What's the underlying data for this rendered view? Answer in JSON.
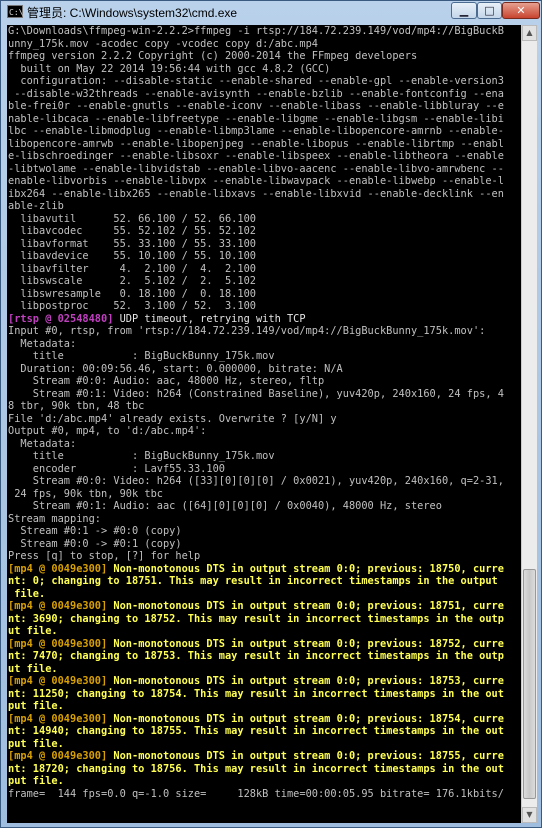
{
  "window": {
    "app_icon_text": "C:\\",
    "title": "管理员: C:\\Windows\\system32\\cmd.exe",
    "minimize_symbol": "▁",
    "maximize_symbol": "□",
    "close_symbol": "✕"
  },
  "console_lines": [
    {
      "t": "G:\\Downloads\\ffmpeg-win-2.2.2>ffmpeg -i rtsp://184.72.239.149/vod/mp4://BigBuckB"
    },
    {
      "t": "unny_175k.mov -acodec copy -vcodec copy d:/abc.mp4"
    },
    {
      "t": "ffmpeg version 2.2.2 Copyright (c) 2000-2014 the FFmpeg developers"
    },
    {
      "t": "  built on May 22 2014 19:56:44 with gcc 4.8.2 (GCC)"
    },
    {
      "t": "  configuration: --disable-static --enable-shared --enable-gpl --enable-version3"
    },
    {
      "t": " --disable-w32threads --enable-avisynth --enable-bzlib --enable-fontconfig --ena"
    },
    {
      "t": "ble-frei0r --enable-gnutls --enable-iconv --enable-libass --enable-libbluray --e"
    },
    {
      "t": "nable-libcaca --enable-libfreetype --enable-libgme --enable-libgsm --enable-libi"
    },
    {
      "t": "lbc --enable-libmodplug --enable-libmp3lame --enable-libopencore-amrnb --enable-"
    },
    {
      "t": "libopencore-amrwb --enable-libopenjpeg --enable-libopus --enable-librtmp --enabl"
    },
    {
      "t": "e-libschroedinger --enable-libsoxr --enable-libspeex --enable-libtheora --enable"
    },
    {
      "t": "-libtwolame --enable-libvidstab --enable-libvo-aacenc --enable-libvo-amrwbenc --"
    },
    {
      "t": "enable-libvorbis --enable-libvpx --enable-libwavpack --enable-libwebp --enable-l"
    },
    {
      "t": "ibx264 --enable-libx265 --enable-libxavs --enable-libxvid --enable-decklink --en"
    },
    {
      "t": "able-zlib"
    },
    {
      "t": "  libavutil      52. 66.100 / 52. 66.100"
    },
    {
      "t": "  libavcodec     55. 52.102 / 55. 52.102"
    },
    {
      "t": "  libavformat    55. 33.100 / 55. 33.100"
    },
    {
      "t": "  libavdevice    55. 10.100 / 55. 10.100"
    },
    {
      "t": "  libavfilter     4.  2.100 /  4.  2.100"
    },
    {
      "t": "  libswscale      2.  5.102 /  2.  5.102"
    },
    {
      "t": "  libswresample   0. 18.100 /  0. 18.100"
    },
    {
      "t": "  libpostproc    52.  3.100 / 52.  3.100"
    },
    {
      "tag": "[rtsp @ 02548480] ",
      "tag_style": "violet",
      "t": "UDP timeout, retrying with TCP",
      "style": "bright"
    },
    {
      "t": "Input #0, rtsp, from 'rtsp://184.72.239.149/vod/mp4://BigBuckBunny_175k.mov':"
    },
    {
      "t": "  Metadata:"
    },
    {
      "t": "    title           : BigBuckBunny_175k.mov"
    },
    {
      "t": "  Duration: 00:09:56.46, start: 0.000000, bitrate: N/A"
    },
    {
      "t": "    Stream #0:0: Audio: aac, 48000 Hz, stereo, fltp"
    },
    {
      "t": "    Stream #0:1: Video: h264 (Constrained Baseline), yuv420p, 240x160, 24 fps, 4"
    },
    {
      "t": "8 tbr, 90k tbn, 48 tbc"
    },
    {
      "t": "File 'd:/abc.mp4' already exists. Overwrite ? [y/N] y"
    },
    {
      "t": "Output #0, mp4, to 'd:/abc.mp4':"
    },
    {
      "t": "  Metadata:"
    },
    {
      "t": "    title           : BigBuckBunny_175k.mov"
    },
    {
      "t": "    encoder         : Lavf55.33.100"
    },
    {
      "t": "    Stream #0:0: Video: h264 ([33][0][0][0] / 0x0021), yuv420p, 240x160, q=2-31,"
    },
    {
      "t": " 24 fps, 90k tbn, 90k tbc"
    },
    {
      "t": "    Stream #0:1: Audio: aac ([64][0][0][0] / 0x0040), 48000 Hz, stereo"
    },
    {
      "t": "Stream mapping:"
    },
    {
      "t": "  Stream #0:1 -> #0:0 (copy)"
    },
    {
      "t": "  Stream #0:0 -> #0:1 (copy)"
    },
    {
      "t": "Press [q] to stop, [?] for help"
    },
    {
      "tag": "[mp4 @ 0049e300] ",
      "tag_style": "yellow",
      "t": "Non-monotonous DTS in output stream 0:0; previous: 18750, curre",
      "style": "yellow"
    },
    {
      "t": "nt: 0; changing to 18751. This may result in incorrect timestamps in the output",
      "style": "yellow"
    },
    {
      "t": " file.",
      "style": "yellow"
    },
    {
      "tag": "[mp4 @ 0049e300] ",
      "tag_style": "yellow",
      "t": "Non-monotonous DTS in output stream 0:0; previous: 18751, curre",
      "style": "yellow"
    },
    {
      "t": "nt: 3690; changing to 18752. This may result in incorrect timestamps in the outp",
      "style": "yellow"
    },
    {
      "t": "ut file.",
      "style": "yellow"
    },
    {
      "tag": "[mp4 @ 0049e300] ",
      "tag_style": "yellow",
      "t": "Non-monotonous DTS in output stream 0:0; previous: 18752, curre",
      "style": "yellow"
    },
    {
      "t": "nt: 7470; changing to 18753. This may result in incorrect timestamps in the outp",
      "style": "yellow"
    },
    {
      "t": "ut file.",
      "style": "yellow"
    },
    {
      "tag": "[mp4 @ 0049e300] ",
      "tag_style": "yellow",
      "t": "Non-monotonous DTS in output stream 0:0; previous: 18753, curre",
      "style": "yellow"
    },
    {
      "t": "nt: 11250; changing to 18754. This may result in incorrect timestamps in the out",
      "style": "yellow"
    },
    {
      "t": "put file.",
      "style": "yellow"
    },
    {
      "tag": "[mp4 @ 0049e300] ",
      "tag_style": "yellow",
      "t": "Non-monotonous DTS in output stream 0:0; previous: 18754, curre",
      "style": "yellow"
    },
    {
      "t": "nt: 14940; changing to 18755. This may result in incorrect timestamps in the out",
      "style": "yellow"
    },
    {
      "t": "put file.",
      "style": "yellow"
    },
    {
      "tag": "[mp4 @ 0049e300] ",
      "tag_style": "yellow",
      "t": "Non-monotonous DTS in output stream 0:0; previous: 18755, curre",
      "style": "yellow"
    },
    {
      "t": "nt: 18720; changing to 18756. This may result in incorrect timestamps in the out",
      "style": "yellow"
    },
    {
      "t": "put file.",
      "style": "yellow"
    },
    {
      "t": "frame=  144 fps=0.0 q=-1.0 size=     128kB time=00:00:05.95 bitrate= 176.1kbits/"
    }
  ],
  "scrollbar": {
    "up_symbol": "▲",
    "down_symbol": "▼",
    "position_fraction": 0.985,
    "visible_fraction": 0.3
  }
}
